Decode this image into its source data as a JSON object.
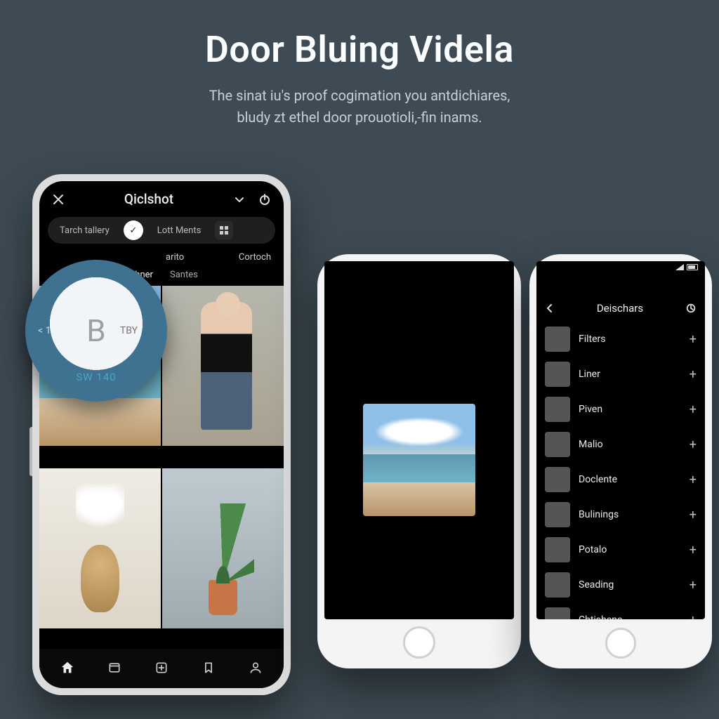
{
  "hero": {
    "title": "Door Bluing Videla",
    "line1": "The sinat iu's proof cogimation you antdichiares,",
    "line2": "bludy zt ethel door prouotioli,-fin inams."
  },
  "phone1": {
    "app_title": "Qiclshot",
    "chip_gallery": "Tarch tallery",
    "chip_circle_glyph": "✓",
    "chip_ments": "Lott Ments",
    "subbar_left": "arito",
    "subbar_right": "Cortoch",
    "tab1": "dchner",
    "tab2": "Santes",
    "circle": {
      "letter": "B",
      "left_label": "< 1",
      "right_label": "TBY",
      "bottom_label": "SW 140"
    }
  },
  "phone3": {
    "header": "Deischars",
    "items": [
      {
        "label": "Filters",
        "thumb": "th-people"
      },
      {
        "label": "Liner",
        "thumb": "th-flowers"
      },
      {
        "label": "Piven",
        "thumb": "th-house"
      },
      {
        "label": "Malio",
        "thumb": "th-beach"
      },
      {
        "label": "Doclente",
        "thumb": "th-interior"
      },
      {
        "label": "Bulinings",
        "thumb": "th-mtn"
      },
      {
        "label": "Potalo",
        "thumb": "th-sunset"
      },
      {
        "label": "Seading",
        "thumb": "th-sky"
      },
      {
        "label": "Chtishene",
        "thumb": "th-rock"
      }
    ]
  }
}
